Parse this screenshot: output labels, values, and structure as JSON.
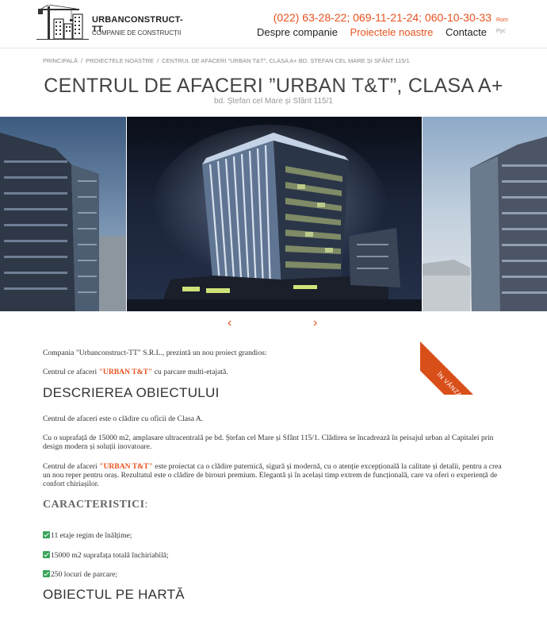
{
  "header": {
    "logo_name": "URBANCONSTRUCT-TT",
    "logo_sub": "COMPANIE DE CONSTRUCȚII",
    "phones": "(022) 63-28-22; 069-11-21-24; 060-10-30-33",
    "nav": [
      "Despre companie",
      "Proiectele noastre",
      "Contacte"
    ],
    "nav_active_index": 1,
    "languages": [
      "Rom",
      "Рус"
    ],
    "active_language": "Rom",
    "accent_color": "#e8521f"
  },
  "breadcrumb": [
    "PRINCIPALĂ",
    "PROIECTELE NOASTRE",
    "CENTRUL DE AFACERI \"URBAN T&T\", CLASA A+ BD. ȘTEFAN CEL MARE ȘI SFÂNT 115/1"
  ],
  "page": {
    "title": "CENTRUL DE AFACERI ”URBAN T&T”, CLASA A+",
    "subtitle": "bd. Ștefan cel Mare și Sfânt 115/1"
  },
  "slider": {
    "prev_icon": "chevron-left-icon",
    "next_icon": "chevron-right-icon",
    "prev_glyph": "‹",
    "next_glyph": "›"
  },
  "ribbon": "ÎN VÂNZARE",
  "content": {
    "intro": "Compania \"Urbanconstruct-TT\" S.R.L., prezintă un nou proiect grandios:",
    "center_before": "Centrul ce afaceri ",
    "center_highlight": "\"URBAN T&T\"",
    "center_after": " cu parcare multi-etajată.",
    "section_description": "DESCRIEREA OBIECTULUI",
    "desc_p1": "Centrul de afaceri este o clădire cu oficii de Clasa A.",
    "desc_p2": "Cu o suprafață de 15000 m2, amplasare ultracentrală pe bd. Ștefan cel Mare și Sfânt 115/1. Clădirea se încadrează în peisajul urban al Capitalei prin design modern și soluții inovatoare.",
    "desc_p3_before": "Centrul de afaceri ",
    "desc_p3_highlight": "\"URBAN T&T\"",
    "desc_p3_after": " este proiectat ca o clădire puternică, sigură și modernă, cu o atenție excepțională la calitate și detalii, pentru a crea un nou reper pentru oraș. Rezultatul este o clădire de birouri premium. Elegantă și în același timp extrem de funcțională, care va oferi o experiență de confort chiriașilor.",
    "section_features": "CARACTERISTICI",
    "section_features_colon": ":",
    "features": [
      "11 etaje regim de înălțime;",
      "15000 m2 suprafața totală închiriabilă;",
      "250 locuri de parcare;"
    ],
    "section_map": "OBIECTUL PE HARTĂ"
  }
}
